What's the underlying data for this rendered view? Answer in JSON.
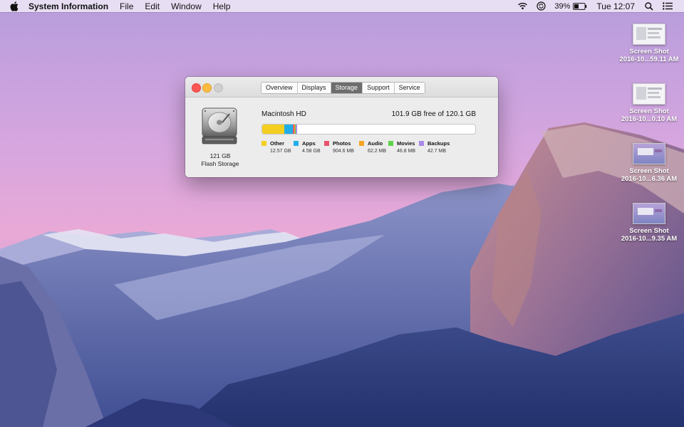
{
  "menubar": {
    "app_name": "System Information",
    "menus": [
      "File",
      "Edit",
      "Window",
      "Help"
    ],
    "battery_percent": "39%",
    "clock": "Tue 12:07",
    "icons": [
      "apple-icon",
      "wifi-icon",
      "sync-icon",
      "battery-icon",
      "spotlight-icon",
      "notification-center-icon"
    ]
  },
  "desktop": {
    "files": [
      {
        "name_line1": "Screen Shot",
        "name_line2": "2016-10...59.11 AM"
      },
      {
        "name_line1": "Screen Shot",
        "name_line2": "2016-10...0.10 AM"
      },
      {
        "name_line1": "Screen Shot",
        "name_line2": "2016-10...6.36 AM"
      },
      {
        "name_line1": "Screen Shot",
        "name_line2": "2016-10...9.35 AM"
      }
    ]
  },
  "window": {
    "tabs": [
      "Overview",
      "Displays",
      "Storage",
      "Support",
      "Service"
    ],
    "active_tab": "Storage",
    "drive": {
      "capacity": "121 GB",
      "type": "Flash Storage"
    },
    "volume": {
      "name": "Macintosh HD",
      "free_text": "101.9 GB free of 120.1 GB",
      "capacity_gb": 120.1
    },
    "categories": [
      {
        "label": "Other",
        "size": "12.57 GB",
        "gb": 12.57,
        "color": "#f5cf20"
      },
      {
        "label": "Apps",
        "size": "4.58 GB",
        "gb": 4.58,
        "color": "#21aee8"
      },
      {
        "label": "Photos",
        "size": "904.6 MB",
        "gb": 0.9046,
        "color": "#e8546d"
      },
      {
        "label": "Audio",
        "size": "62.2 MB",
        "gb": 0.0622,
        "color": "#f5a524"
      },
      {
        "label": "Movies",
        "size": "46.8 MB",
        "gb": 0.0468,
        "color": "#5ed34b"
      },
      {
        "label": "Backups",
        "size": "42.7 MB",
        "gb": 0.0427,
        "color": "#a98ae6"
      }
    ]
  }
}
